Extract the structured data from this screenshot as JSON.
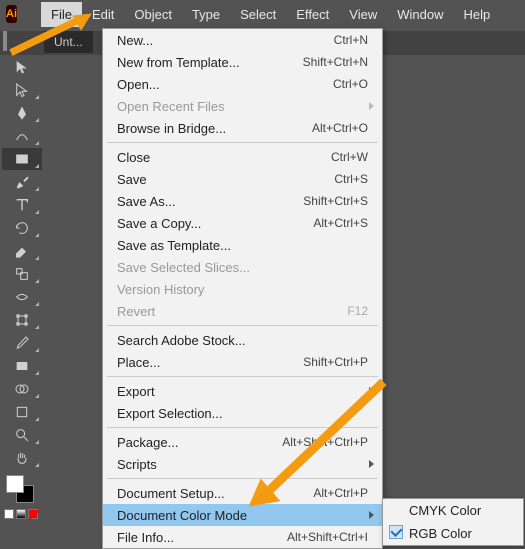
{
  "app": {
    "logo": "Ai"
  },
  "menubar": [
    "File",
    "Edit",
    "Object",
    "Type",
    "Select",
    "Effect",
    "View",
    "Window",
    "Help"
  ],
  "doctab": "Unt...",
  "fileMenu": {
    "g1": [
      {
        "label": "New...",
        "short": "Ctrl+N"
      },
      {
        "label": "New from Template...",
        "short": "Shift+Ctrl+N"
      },
      {
        "label": "Open...",
        "short": "Ctrl+O"
      },
      {
        "label": "Open Recent Files",
        "sub": true,
        "disabled": true
      },
      {
        "label": "Browse in Bridge...",
        "short": "Alt+Ctrl+O"
      }
    ],
    "g2": [
      {
        "label": "Close",
        "short": "Ctrl+W"
      },
      {
        "label": "Save",
        "short": "Ctrl+S"
      },
      {
        "label": "Save As...",
        "short": "Shift+Ctrl+S"
      },
      {
        "label": "Save a Copy...",
        "short": "Alt+Ctrl+S"
      },
      {
        "label": "Save as Template..."
      },
      {
        "label": "Save Selected Slices...",
        "disabled": true
      },
      {
        "label": "Version History",
        "disabled": true
      },
      {
        "label": "Revert",
        "short": "F12",
        "disabled": true
      }
    ],
    "g3": [
      {
        "label": "Search Adobe Stock..."
      },
      {
        "label": "Place...",
        "short": "Shift+Ctrl+P"
      }
    ],
    "g4": [
      {
        "label": "Export",
        "sub": true
      },
      {
        "label": "Export Selection..."
      }
    ],
    "g5": [
      {
        "label": "Package...",
        "short": "Alt+Shift+Ctrl+P"
      },
      {
        "label": "Scripts",
        "sub": true
      }
    ],
    "g6": [
      {
        "label": "Document Setup...",
        "short": "Alt+Ctrl+P"
      },
      {
        "label": "Document Color Mode",
        "sub": true,
        "hl": true
      },
      {
        "label": "File Info...",
        "short": "Alt+Shift+Ctrl+I"
      }
    ]
  },
  "submenu": [
    {
      "label": "CMYK Color"
    },
    {
      "label": "RGB Color",
      "checked": true
    }
  ]
}
